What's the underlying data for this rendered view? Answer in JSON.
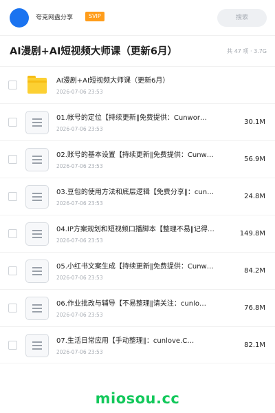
{
  "header": {
    "app_name": "夸克网盘分享",
    "badge": "SVIP",
    "search_placeholder": "搜索"
  },
  "folder": {
    "title": "AI漫剧+AI短视频大师课（更新6月）",
    "meta": "共 47 项 · 3.7G"
  },
  "items": [
    {
      "type": "folder",
      "name": "AI漫剧+AI短视频大师课（更新6月）",
      "date": "2026-07-06 23:53",
      "size": ""
    },
    {
      "type": "doc",
      "name": "01.帐号的定位【持续更新‖免费提供：Cunwor…",
      "date": "2026-07-06 23:53",
      "size": "30.1M"
    },
    {
      "type": "doc",
      "name": "02.账号的基本设置【持续更新‖免费提供：Cunw…",
      "date": "2026-07-06 23:53",
      "size": "56.9M"
    },
    {
      "type": "doc",
      "name": "03.豆包的使用方法和底层逻辑【免费分享‖：cun…",
      "date": "2026-07-06 23:53",
      "size": "24.8M"
    },
    {
      "type": "doc",
      "name": "04.IP方案规划和短视频口播脚本【整理不易‖记得…",
      "date": "2026-07-06 23:53",
      "size": "149.8M"
    },
    {
      "type": "doc",
      "name": "05.小红书文案生成【持续更新‖免费提供：Cunw…",
      "date": "2026-07-06 23:53",
      "size": "84.2M"
    },
    {
      "type": "doc",
      "name": "06.作业批改与辅导【不易整理‖请关注：cunlo…",
      "date": "2026-07-06 23:53",
      "size": "76.8M"
    },
    {
      "type": "doc",
      "name": "07.生活日常应用【手动整理‖：cunlove.C…",
      "date": "2026-07-06 23:53",
      "size": "82.1M"
    }
  ],
  "watermark": "miosou.cc",
  "colors": {
    "avatar": "#1a73f0",
    "badge": "#ff9d1b",
    "folder_icon": "#fcd033",
    "watermark": "#13c85b"
  },
  "icons": {
    "folder": "folder-icon",
    "file": "document-icon"
  }
}
